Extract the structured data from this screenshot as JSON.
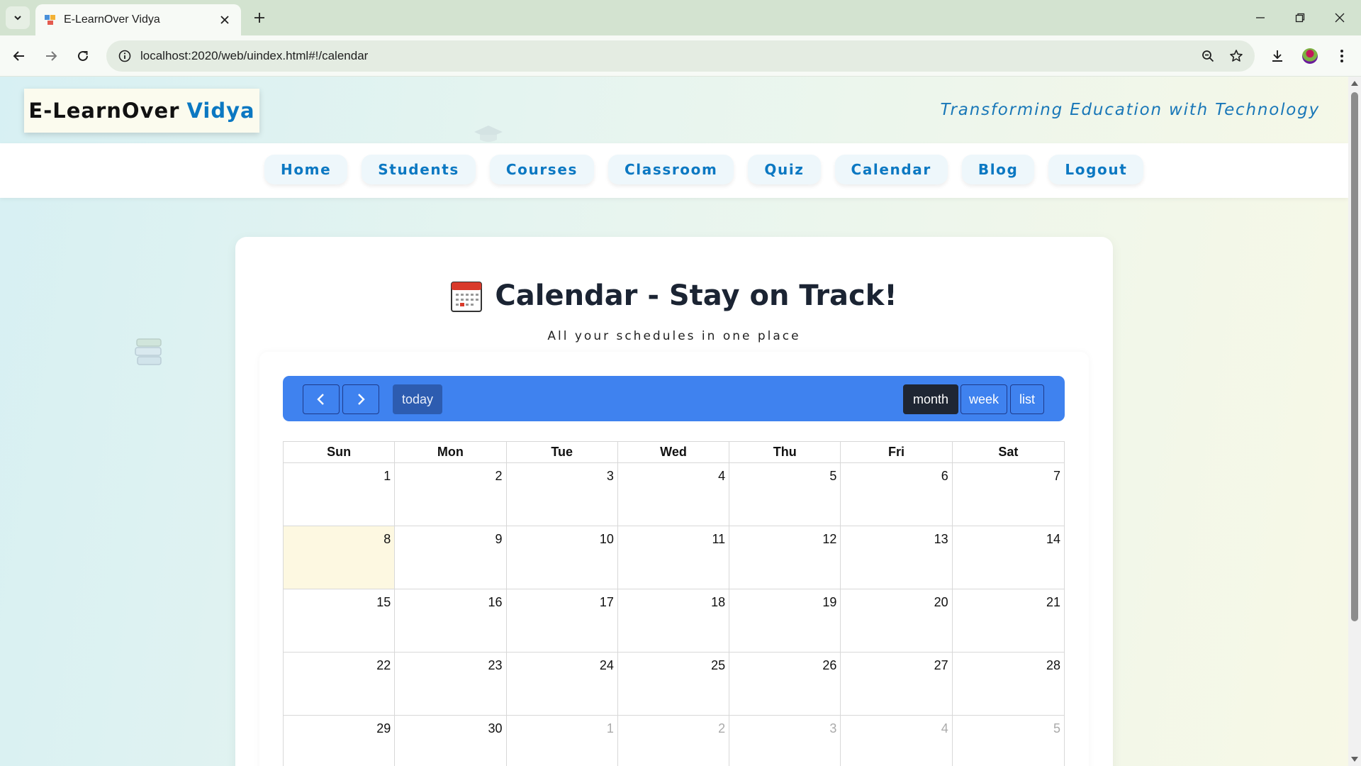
{
  "browser": {
    "tab_title": "E-LearnOver Vidya",
    "url": "localhost:2020/web/uindex.html#!/calendar"
  },
  "site": {
    "brand_main": "E-LearnOver",
    "brand_accent": "Vidya",
    "tagline": "Transforming Education with Technology",
    "nav": [
      "Home",
      "Students",
      "Courses",
      "Classroom",
      "Quiz",
      "Calendar",
      "Blog",
      "Logout"
    ]
  },
  "calendar": {
    "title": "Calendar - Stay on Track!",
    "subtitle": "All your schedules in one place",
    "toolbar": {
      "prev_icon": "chevron-left-icon",
      "next_icon": "chevron-right-icon",
      "today_label": "today",
      "views": [
        "month",
        "week",
        "list"
      ],
      "active_view": "month"
    },
    "weekdays": [
      "Sun",
      "Mon",
      "Tue",
      "Wed",
      "Thu",
      "Fri",
      "Sat"
    ],
    "weeks": [
      [
        "1",
        "2",
        "3",
        "4",
        "5",
        "6",
        "7"
      ],
      [
        "8",
        "9",
        "10",
        "11",
        "12",
        "13",
        "14"
      ],
      [
        "15",
        "16",
        "17",
        "18",
        "19",
        "20",
        "21"
      ],
      [
        "22",
        "23",
        "24",
        "25",
        "26",
        "27",
        "28"
      ],
      [
        "29",
        "30",
        "1",
        "2",
        "3",
        "4",
        "5"
      ]
    ],
    "highlighted_day": "8",
    "next_month_days_in_last_week": [
      "1",
      "2",
      "3",
      "4",
      "5"
    ]
  },
  "colors": {
    "accent": "#0b78c2",
    "toolbar_blue": "#3f82ef",
    "active_view": "#1f2633",
    "today_cell": "#fdf8e1"
  }
}
